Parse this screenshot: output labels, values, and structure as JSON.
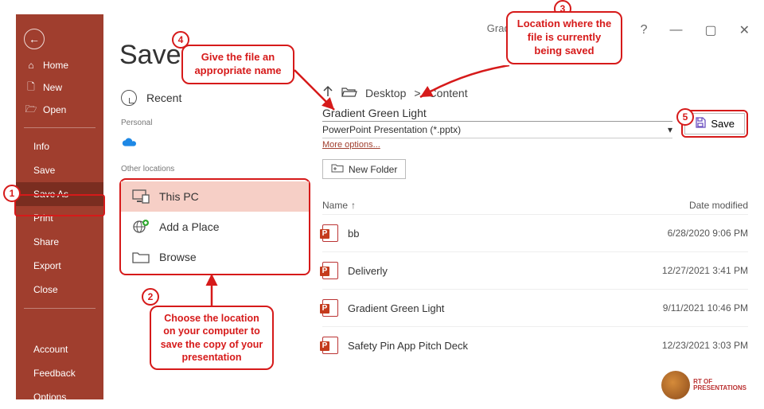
{
  "window": {
    "doc_title": "Gradient Green Light"
  },
  "sidebar": {
    "home": "Home",
    "new": "New",
    "open": "Open",
    "info": "Info",
    "save": "Save",
    "saveas": "Save As",
    "print": "Print",
    "share": "Share",
    "export": "Export",
    "close": "Close",
    "account": "Account",
    "feedback": "Feedback",
    "options": "Options"
  },
  "mid": {
    "title": "Save A",
    "recent": "Recent",
    "personal": "Personal",
    "other": "Other locations",
    "thispc": "This PC",
    "addplace": "Add a Place",
    "browse": "Browse"
  },
  "main": {
    "path1": "Desktop",
    "path2": "Content",
    "filename": "Gradient Green Light",
    "filetype": "PowerPoint Presentation (*.pptx)",
    "more": "More options...",
    "newfolder": "New Folder",
    "save": "Save",
    "col_name": "Name",
    "col_date": "Date modified",
    "files": [
      {
        "name": "bb",
        "date": "6/28/2020 9:06 PM"
      },
      {
        "name": "Deliverly",
        "date": "12/27/2021 3:41 PM"
      },
      {
        "name": "Gradient Green Light",
        "date": "9/11/2021 10:46 PM"
      },
      {
        "name": "Safety Pin App Pitch Deck",
        "date": "12/23/2021 3:03 PM"
      }
    ]
  },
  "callouts": {
    "c2": "Choose the location on your computer to save the copy of your presentation",
    "c3": "Location where the file is currently being saved",
    "c4": "Give the file an appropriate name"
  },
  "badges": {
    "b1": "1",
    "b2": "2",
    "b3": "3",
    "b4": "4",
    "b5": "5"
  },
  "logo": {
    "l1": "RT OF",
    "l2": "PRESENTATIONS"
  }
}
